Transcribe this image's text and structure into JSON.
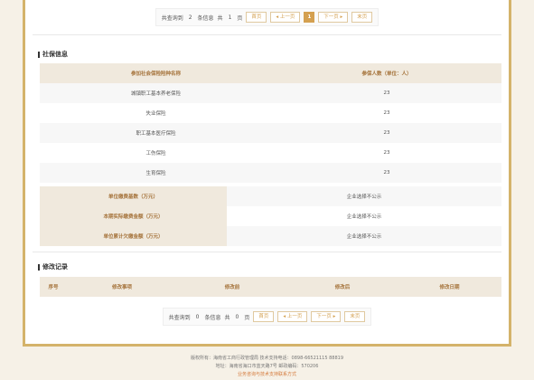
{
  "pager_top": {
    "prefix": "共查询到",
    "count": "2",
    "unit": "条信息",
    "pages_prefix": "共",
    "pages": "1",
    "pages_unit": "页",
    "first": "首页",
    "prev": "◂ 上一页",
    "current": "1",
    "next": "下一页 ▸",
    "last": "末页"
  },
  "social": {
    "title": "社保信息",
    "col1": "参加社会保险险种名称",
    "col2": "参保人数（单位：人）",
    "rows": [
      {
        "name": "城镇职工基本养老保险",
        "count": "23"
      },
      {
        "name": "失业保险",
        "count": "23"
      },
      {
        "name": "职工基本医疗保险",
        "count": "23"
      },
      {
        "name": "工伤保险",
        "count": "23"
      },
      {
        "name": "生育保险",
        "count": "23"
      }
    ],
    "kv": [
      {
        "k": "单位缴费基数（万元）",
        "v": "企业选择不公示"
      },
      {
        "k": "本期实际缴费金额（万元）",
        "v": "企业选择不公示"
      },
      {
        "k": "单位累计欠缴金额（万元）",
        "v": "企业选择不公示"
      }
    ]
  },
  "changes": {
    "title": "修改记录",
    "cols": [
      "序号",
      "修改事项",
      "修改前",
      "修改后",
      "修改日期"
    ]
  },
  "pager_bottom": {
    "prefix": "共查询到",
    "count": "0",
    "unit": "条信息",
    "pages_prefix": "共",
    "pages": "0",
    "pages_unit": "页",
    "first": "首页",
    "prev": "◂ 上一页",
    "next": "下一页 ▸",
    "last": "末页"
  },
  "footer": {
    "line1": "版权所有：海南省工商行政管理局 技术支持电话：0898-66521115 88819",
    "line2": "地址：海南省海口市蓝天路7号 邮政编码：570206",
    "link": "业务咨询与技术支持联系方式"
  }
}
